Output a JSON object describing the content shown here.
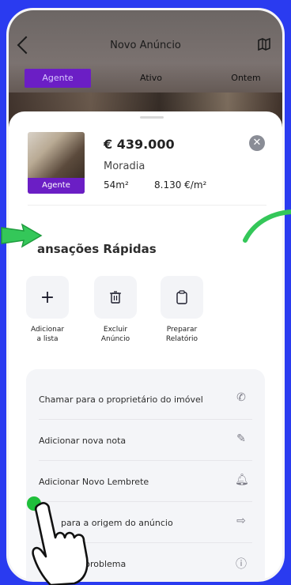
{
  "header": {
    "title": "Novo Anúncio",
    "back_icon": "chevron-left-icon",
    "map_icon": "map-icon"
  },
  "tabs": [
    {
      "label": "Agente",
      "active": true
    },
    {
      "label": "Ativo",
      "active": false
    },
    {
      "label": "Ontem",
      "active": false
    }
  ],
  "listing": {
    "badge": "Agente",
    "price": "€ 439.000",
    "type": "Moradia",
    "area": "54m²",
    "price_per_m2": "8.130 €/m²"
  },
  "quick_section": {
    "title": "ansações Rápidas",
    "items": [
      {
        "label_line1": "Adicionar",
        "label_line2": "a lista",
        "icon": "plus-icon"
      },
      {
        "label_line1": "Excluir",
        "label_line2": "Anúncio",
        "icon": "trash-icon"
      },
      {
        "label_line1": "Preparar",
        "label_line2": "Relatório",
        "icon": "clipboard-icon"
      }
    ]
  },
  "actions": [
    {
      "label": "Chamar para o proprietário do imóvel",
      "icon": "phone-outgoing-icon"
    },
    {
      "label": "Adicionar nova nota",
      "icon": "edit-note-icon"
    },
    {
      "label": "Adicionar Novo Lembrete",
      "icon": "bell-icon"
    },
    {
      "label": "para a origem do anúncio",
      "icon": "arrow-circle-right-icon"
    },
    {
      "label": "problema",
      "icon": "info-circle-icon"
    }
  ],
  "colors": {
    "background": "#2a3bf0",
    "accent": "#6b1ec5",
    "highlight": "#1fbf3a"
  }
}
